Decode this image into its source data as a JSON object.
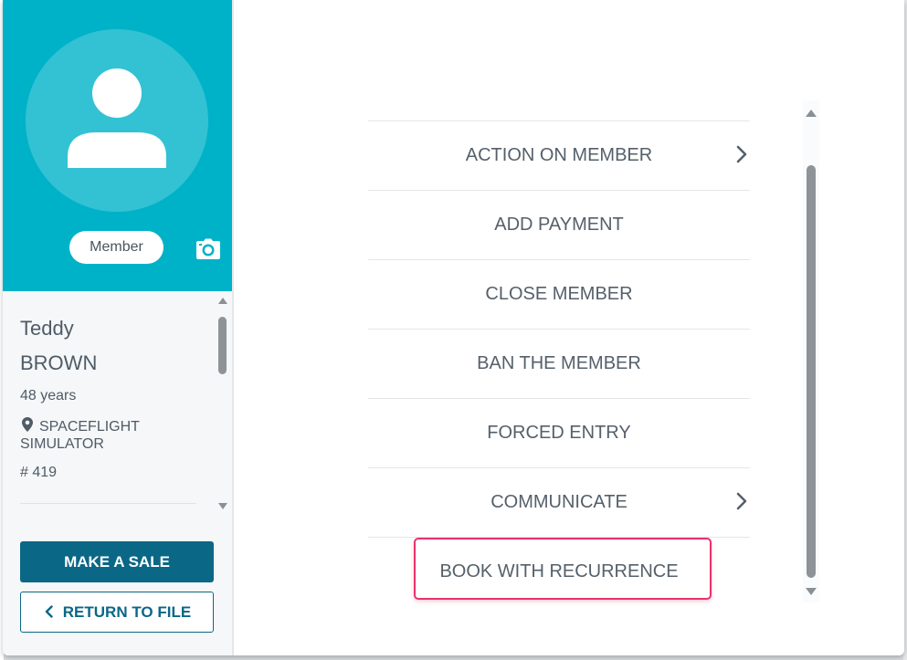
{
  "profile": {
    "badge": "Member",
    "first_name": "Teddy",
    "last_name": "BROWN",
    "age": "48 years",
    "location": "SPACEFLIGHT SIMULATOR",
    "member_number": "# 419",
    "camera_icon": "camera-icon",
    "location_icon": "map-pin-icon"
  },
  "buttons": {
    "make_sale": "MAKE A SALE",
    "return_to_file": "RETURN TO FILE"
  },
  "actions": [
    {
      "label": "ACTION ON MEMBER",
      "has_submenu": true
    },
    {
      "label": "ADD PAYMENT",
      "has_submenu": false
    },
    {
      "label": "CLOSE MEMBER",
      "has_submenu": false
    },
    {
      "label": "BAN THE MEMBER",
      "has_submenu": false
    },
    {
      "label": "FORCED ENTRY",
      "has_submenu": false
    },
    {
      "label": "COMMUNICATE",
      "has_submenu": true
    },
    {
      "label": "BOOK WITH RECURRENCE",
      "has_submenu": false,
      "highlighted": true
    }
  ],
  "colors": {
    "header": "#00b2c8",
    "primary": "#0b6786",
    "highlight": "#e8336a"
  }
}
